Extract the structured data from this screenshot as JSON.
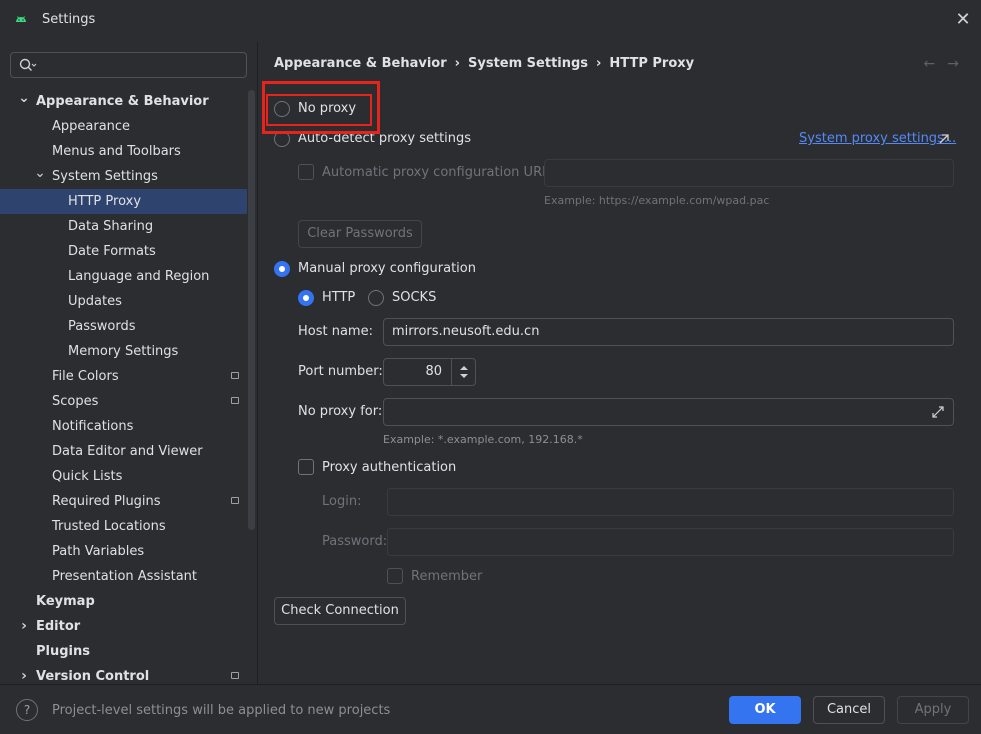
{
  "window": {
    "title": "Settings"
  },
  "search": {
    "placeholder": ""
  },
  "sidebar": {
    "items": [
      {
        "label": "Appearance & Behavior",
        "level": 0,
        "bold": true,
        "expanded": true
      },
      {
        "label": "Appearance",
        "level": 1
      },
      {
        "label": "Menus and Toolbars",
        "level": 1
      },
      {
        "label": "System Settings",
        "level": 1,
        "expanded": true
      },
      {
        "label": "HTTP Proxy",
        "level": 2,
        "selected": true
      },
      {
        "label": "Data Sharing",
        "level": 2
      },
      {
        "label": "Date Formats",
        "level": 2
      },
      {
        "label": "Language and Region",
        "level": 2
      },
      {
        "label": "Updates",
        "level": 2
      },
      {
        "label": "Passwords",
        "level": 2
      },
      {
        "label": "Memory Settings",
        "level": 2
      },
      {
        "label": "File Colors",
        "level": 1,
        "badge": true
      },
      {
        "label": "Scopes",
        "level": 1,
        "badge": true
      },
      {
        "label": "Notifications",
        "level": 1
      },
      {
        "label": "Data Editor and Viewer",
        "level": 1
      },
      {
        "label": "Quick Lists",
        "level": 1
      },
      {
        "label": "Required Plugins",
        "level": 1,
        "badge": true
      },
      {
        "label": "Trusted Locations",
        "level": 1
      },
      {
        "label": "Path Variables",
        "level": 1
      },
      {
        "label": "Presentation Assistant",
        "level": 1
      },
      {
        "label": "Keymap",
        "level": 0,
        "bold": true
      },
      {
        "label": "Editor",
        "level": 0,
        "bold": true,
        "collapsed": true
      },
      {
        "label": "Plugins",
        "level": 0,
        "bold": true
      },
      {
        "label": "Version Control",
        "level": 0,
        "bold": true,
        "collapsed": true,
        "badge": true
      }
    ]
  },
  "breadcrumb": {
    "part1": "Appearance & Behavior",
    "sep": "›",
    "part2": "System Settings",
    "part3": "HTTP Proxy"
  },
  "proxy": {
    "no_proxy": "No proxy",
    "auto_detect": "Auto-detect proxy settings",
    "system_link": "System proxy settings...",
    "auto_config_url_label": "Automatic proxy configuration URL:",
    "auto_config_url_value": "",
    "auto_config_hint": "Example: https://example.com/wpad.pac",
    "clear_passwords": "Clear Passwords",
    "manual": "Manual proxy configuration",
    "http": "HTTP",
    "socks": "SOCKS",
    "host_label": "Host name:",
    "host_value": "mirrors.neusoft.edu.cn",
    "port_label": "Port number:",
    "port_value": "80",
    "no_proxy_for_label": "No proxy for:",
    "no_proxy_for_value": "",
    "no_proxy_for_hint": "Example: *.example.com, 192.168.*",
    "proxy_auth": "Proxy authentication",
    "login_label": "Login:",
    "password_label": "Password:",
    "remember": "Remember",
    "check_connection": "Check Connection"
  },
  "footer": {
    "help": "?",
    "text": "Project-level settings will be applied to new projects",
    "ok": "OK",
    "cancel": "Cancel",
    "apply": "Apply"
  },
  "colors": {
    "accent": "#3574f0",
    "selected_bg": "#2e436e",
    "highlight": "#e8231b",
    "link": "#548af7"
  }
}
